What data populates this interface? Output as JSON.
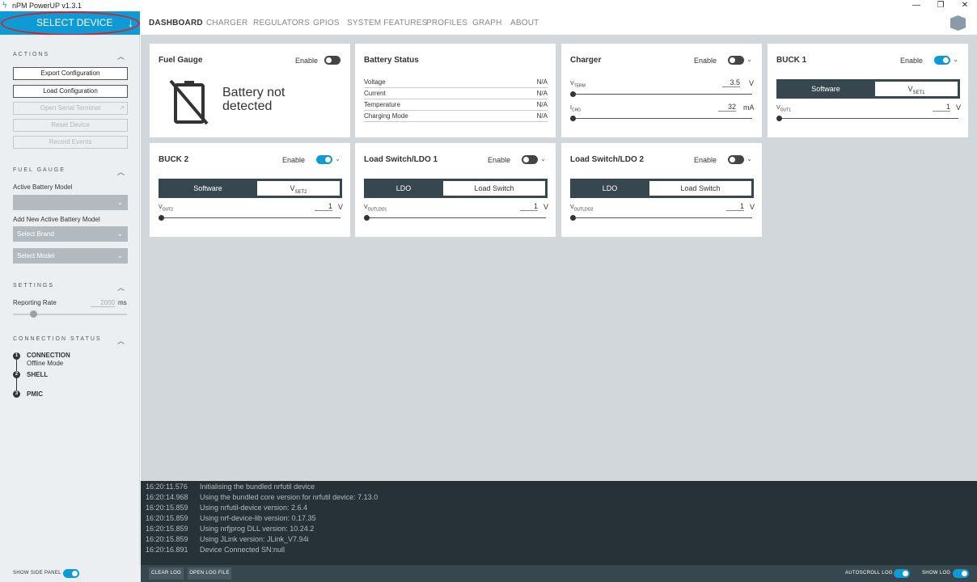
{
  "app": {
    "title": "nPM PowerUP v1.3.1"
  },
  "window": {
    "minimize": "—",
    "restore": "❐",
    "close": "✕"
  },
  "select_device": {
    "label": "SELECT DEVICE",
    "arrow": "↓"
  },
  "nav": {
    "tabs": [
      "DASHBOARD",
      "CHARGER",
      "REGULATORS",
      "GPIOS",
      "SYSTEM FEATURES",
      "PROFILES",
      "GRAPH",
      "ABOUT"
    ],
    "active": "DASHBOARD"
  },
  "sidebar": {
    "actions": {
      "heading": "ACTIONS",
      "buttons": [
        {
          "label": "Export Configuration",
          "enabled": true
        },
        {
          "label": "Load Configuration",
          "enabled": true
        },
        {
          "label": "Open Serial Terminal",
          "enabled": false
        },
        {
          "label": "Reset Device",
          "enabled": false
        },
        {
          "label": "Record Events",
          "enabled": false
        }
      ]
    },
    "fuel_gauge": {
      "heading": "FUEL GAUGE",
      "active_model_label": "Active Battery Model",
      "active_model_value": "",
      "add_model_label": "Add New Active Battery Model",
      "brand_placeholder": "Select Brand",
      "model_placeholder": "Select Model"
    },
    "settings": {
      "heading": "SETTINGS",
      "rate_label": "Reporting Rate",
      "rate_value": "2000",
      "rate_unit": "ms"
    },
    "connection": {
      "heading": "CONNECTION STATUS",
      "steps": [
        {
          "num": "1",
          "title": "CONNECTION",
          "sub": "Offline Mode"
        },
        {
          "num": "2",
          "title": "SHELL",
          "sub": ""
        },
        {
          "num": "3",
          "title": "PMIC",
          "sub": ""
        }
      ]
    }
  },
  "enable_label": "Enable",
  "cards": {
    "fuel_gauge": {
      "title": "Fuel Gauge",
      "enabled": false,
      "message": "Battery not detected"
    },
    "battery_status": {
      "title": "Battery Status",
      "rows": [
        {
          "k": "Voltage",
          "v": "N/A"
        },
        {
          "k": "Current",
          "v": "N/A"
        },
        {
          "k": "Temperature",
          "v": "N/A"
        },
        {
          "k": "Charging Mode",
          "v": "N/A"
        }
      ]
    },
    "charger": {
      "title": "Charger",
      "enabled": false,
      "vterm": {
        "label": "V",
        "sub": "TERM",
        "value": "3.5",
        "unit": "V"
      },
      "ichg": {
        "label": "I",
        "sub": "CHG",
        "value": "32",
        "unit": "mA"
      }
    },
    "buck1": {
      "title": "BUCK 1",
      "enabled": true,
      "seg_a": "Software",
      "seg_b": "V",
      "seg_b_sub": "SET1",
      "param": "V",
      "param_sub": "OUT1",
      "value": "1",
      "unit": "V"
    },
    "buck2": {
      "title": "BUCK 2",
      "enabled": true,
      "seg_a": "Software",
      "seg_b": "V",
      "seg_b_sub": "SET2",
      "param": "V",
      "param_sub": "OUT2",
      "value": "1",
      "unit": "V"
    },
    "ldo1": {
      "title": "Load Switch/LDO 1",
      "enabled": false,
      "seg_a": "LDO",
      "seg_b": "Load Switch",
      "param": "V",
      "param_sub": "OUTLDO1",
      "value": "1",
      "unit": "V"
    },
    "ldo2": {
      "title": "Load Switch/LDO 2",
      "enabled": false,
      "seg_a": "LDO",
      "seg_b": "Load Switch",
      "param": "V",
      "param_sub": "OUTLDO2",
      "value": "1",
      "unit": "V"
    }
  },
  "log": [
    {
      "t": "16:20:11.576",
      "m": "Initialising the bundled nrfutil device"
    },
    {
      "t": "16:20:14.968",
      "m": "Using the bundled core version for nrfutil device: 7.13.0"
    },
    {
      "t": "16:20:15.859",
      "m": "Using nrfutil-device version: 2.6.4"
    },
    {
      "t": "16:20:15.859",
      "m": "Using nrf-device-lib version: 0.17.35"
    },
    {
      "t": "16:20:15.859",
      "m": "Using nrfjprog DLL version: 10.24.2"
    },
    {
      "t": "16:20:15.859",
      "m": "Using JLink version: JLink_V7.94i"
    },
    {
      "t": "16:20:16.891",
      "m": "Device Connected SN:null"
    }
  ],
  "bottom": {
    "show_side_panel": "SHOW SIDE PANEL",
    "clear_log": "CLEAR LOG",
    "open_log_file": "OPEN LOG FILE",
    "autoscroll": "AUTOSCROLL LOG",
    "show_log": "SHOW LOG"
  },
  "colors": {
    "accent": "#0d9ad5",
    "dark": "#37474f",
    "log_bg": "#263238",
    "annotation": "#d8202a"
  }
}
